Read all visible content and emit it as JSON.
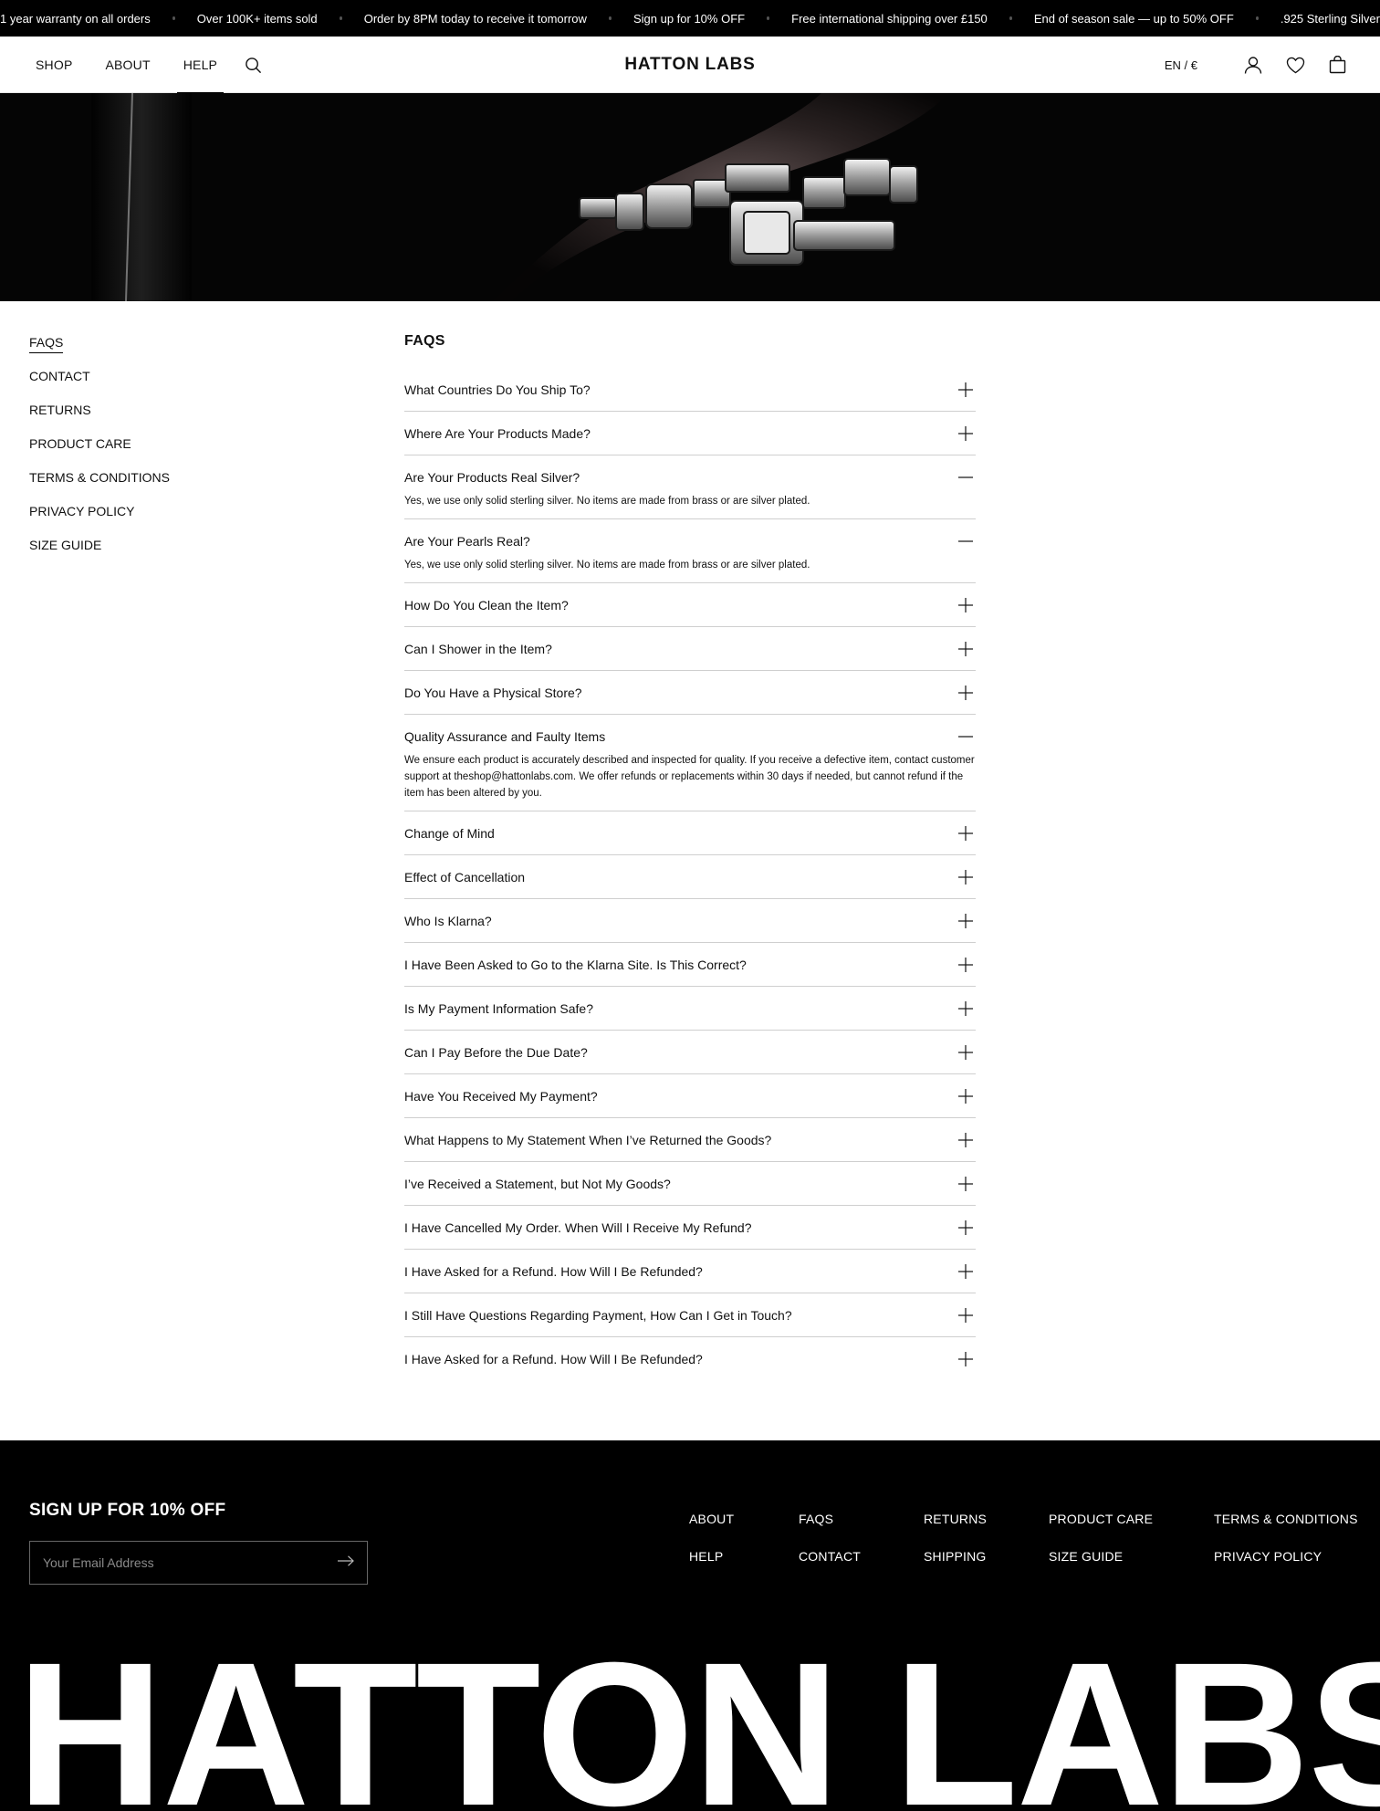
{
  "announcement": {
    "messages": [
      "1 year warranty on all orders",
      "Over 100K+ items sold",
      "Order by 8PM today to receive it tomorrow",
      "Sign up for 10% OFF",
      "Free international shipping over £150",
      "End of season sale — up to 50% OFF",
      ".925 Sterling Silver"
    ]
  },
  "header": {
    "nav": [
      "SHOP",
      "ABOUT",
      "HELP"
    ],
    "active_nav": "HELP",
    "logo": "HATTON LABS",
    "language_currency": "EN / €",
    "icons": [
      "search-icon",
      "account-icon",
      "wishlist-icon",
      "bag-icon"
    ]
  },
  "sidebar": {
    "items": [
      "FAQS",
      "CONTACT",
      "RETURNS",
      "PRODUCT CARE",
      "TERMS & CONDITIONS",
      "PRIVACY POLICY",
      "SIZE GUIDE"
    ],
    "active": "FAQS"
  },
  "faq": {
    "title": "FAQS",
    "items": [
      {
        "q": "What Countries Do You Ship To?",
        "open": false
      },
      {
        "q": "Where Are Your Products Made?",
        "open": false
      },
      {
        "q": "Are Your Products Real Silver?",
        "open": true,
        "a": "Yes, we use only solid sterling silver. No items are made from brass or are silver plated."
      },
      {
        "q": "Are Your Pearls Real?",
        "open": true,
        "a": "Yes, we use only solid sterling silver. No items are made from brass or are silver plated."
      },
      {
        "q": "How Do You Clean the Item?",
        "open": false
      },
      {
        "q": "Can I Shower in the Item?",
        "open": false
      },
      {
        "q": "Do You Have a Physical Store?",
        "open": false
      },
      {
        "q": "Quality Assurance and Faulty Items",
        "open": true,
        "a": "We ensure each product is accurately described and inspected for quality. If you receive a defective item, contact customer support at theshop@hattonlabs.com. We offer refunds or replacements within 30 days if needed, but cannot refund if the item has been altered by you."
      },
      {
        "q": "Change of Mind",
        "open": false
      },
      {
        "q": "Effect of Cancellation",
        "open": false
      },
      {
        "q": "Who Is Klarna?",
        "open": false
      },
      {
        "q": "I Have Been Asked to Go to the Klarna Site. Is This Correct?",
        "open": false
      },
      {
        "q": "Is My Payment Information Safe?",
        "open": false
      },
      {
        "q": "Can I Pay Before the Due Date?",
        "open": false
      },
      {
        "q": "Have You Received My Payment?",
        "open": false
      },
      {
        "q": "What Happens to My Statement When I’ve Returned the Goods?",
        "open": false
      },
      {
        "q": "I’ve Received a Statement, but Not My Goods?",
        "open": false
      },
      {
        "q": "I Have Cancelled My Order. When Will I Receive My Refund?",
        "open": false
      },
      {
        "q": "I Have Asked for a Refund. How Will I Be Refunded?",
        "open": false
      },
      {
        "q": "I Still Have Questions Regarding Payment, How Can I Get in Touch?",
        "open": false
      },
      {
        "q": "I Have Asked for a Refund. How Will I Be Refunded?",
        "open": false
      }
    ]
  },
  "footer": {
    "signup_title": "SIGN UP FOR 10% OFF",
    "email_placeholder": "Your Email Address",
    "link_columns": [
      [
        "ABOUT",
        "HELP"
      ],
      [
        "FAQS",
        "CONTACT"
      ],
      [
        "RETURNS",
        "SHIPPING"
      ],
      [
        "PRODUCT CARE",
        "SIZE GUIDE"
      ],
      [
        "TERMS & CONDITIONS",
        "PRIVACY POLICY"
      ]
    ],
    "wordmark": "HATTON LABS"
  },
  "colors": {
    "black": "#000000",
    "white": "#ffffff",
    "divider": "#cfcfcf"
  }
}
